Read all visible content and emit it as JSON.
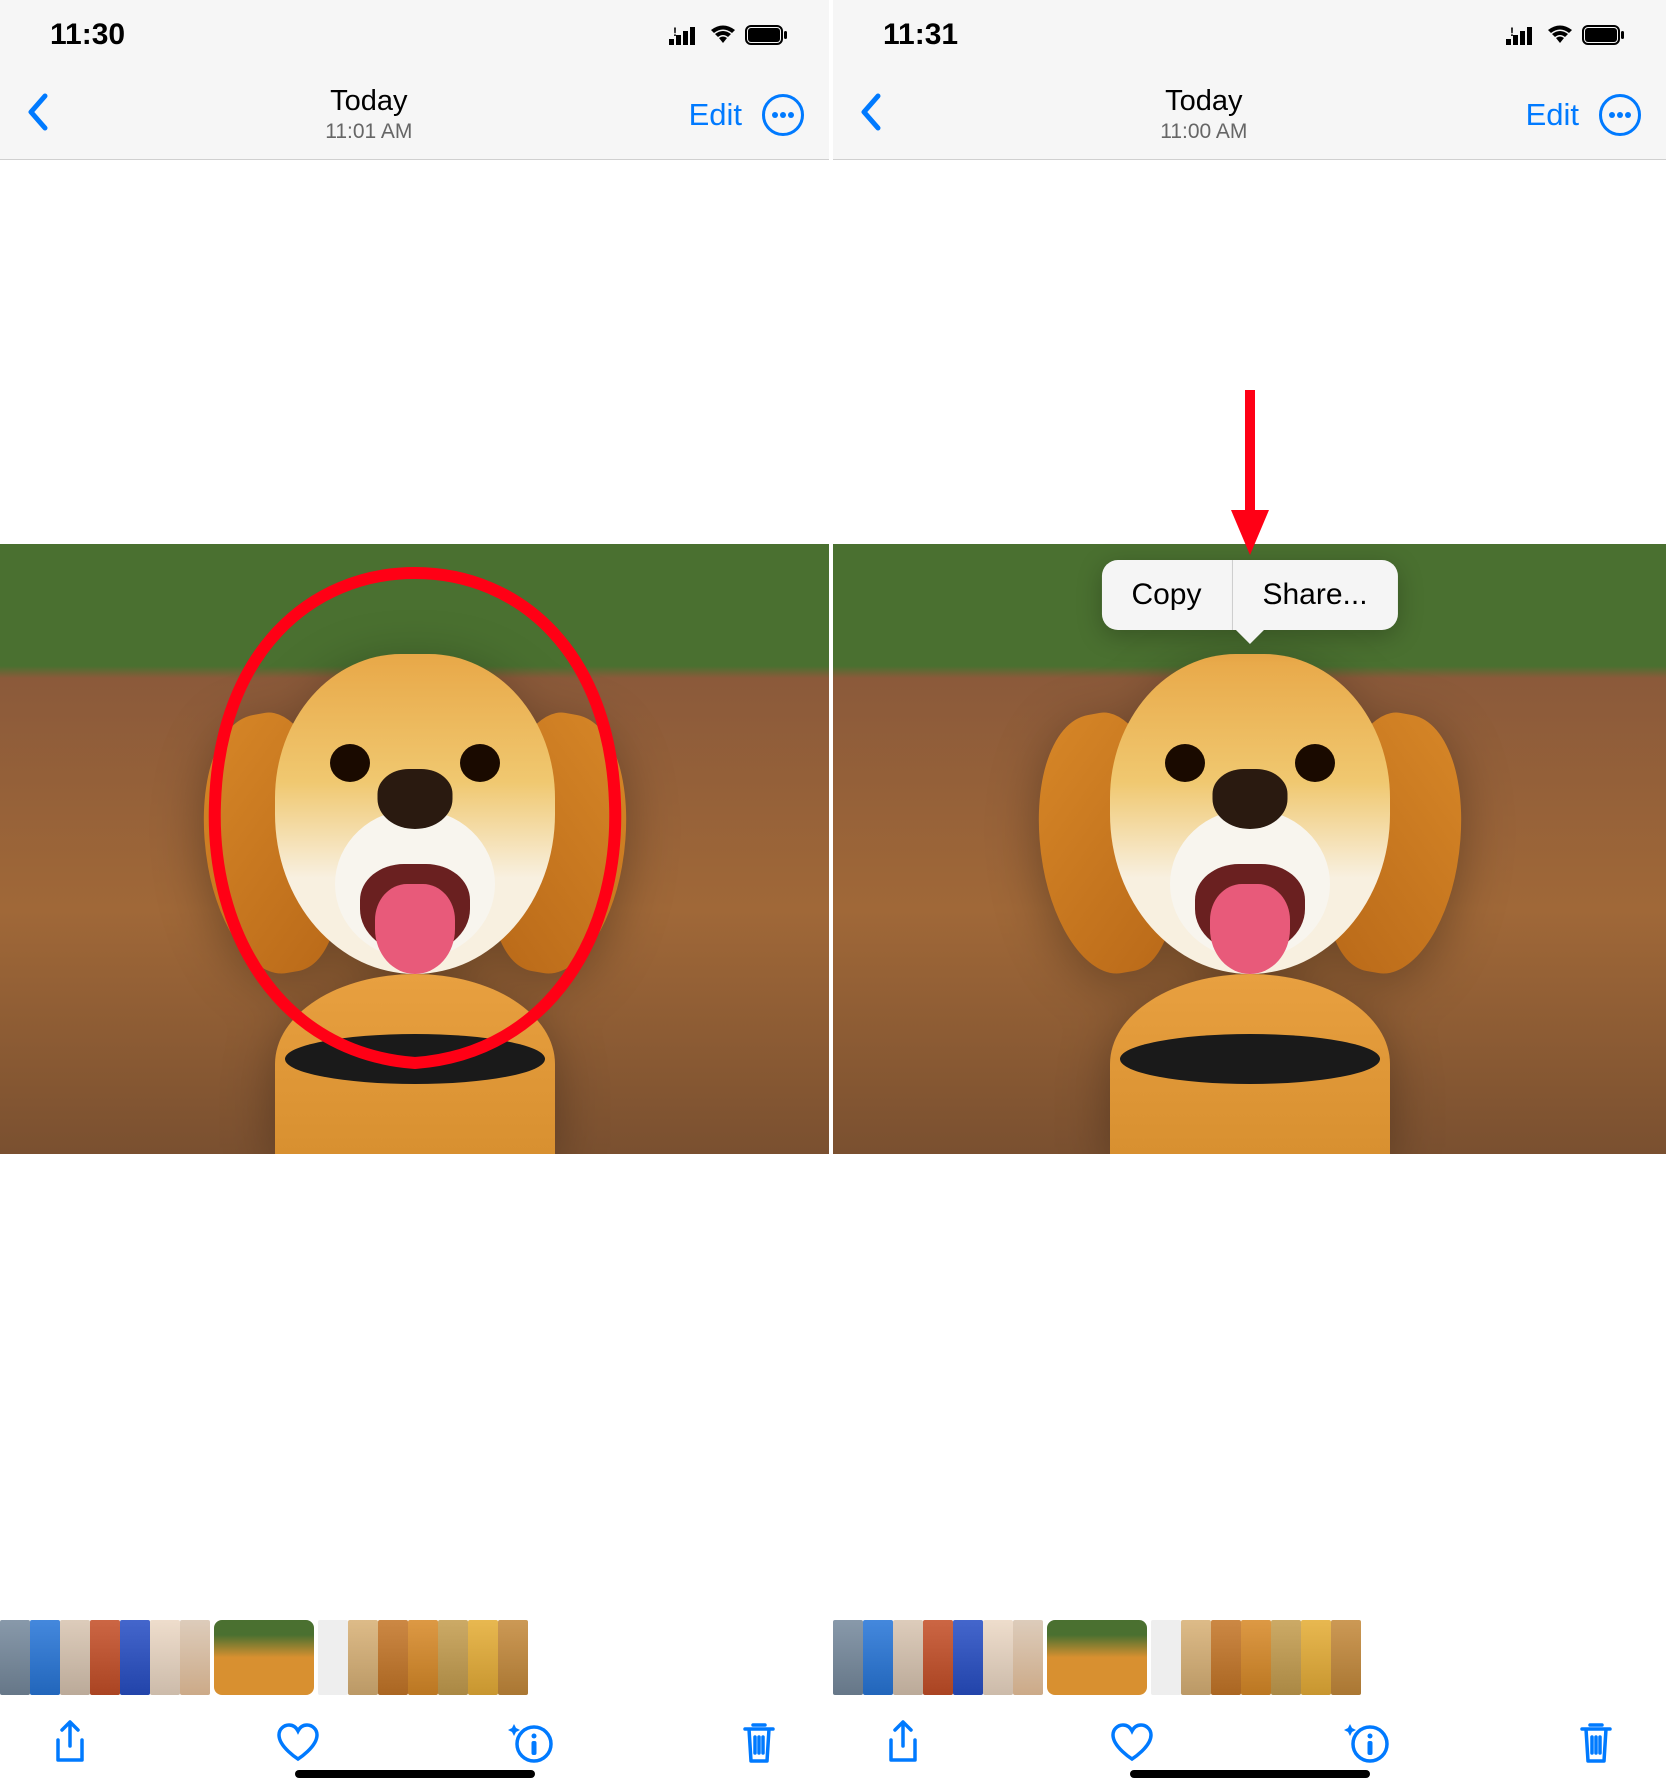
{
  "left": {
    "status": {
      "time": "11:30"
    },
    "nav": {
      "title": "Today",
      "subtitle": "11:01 AM",
      "edit": "Edit"
    }
  },
  "right": {
    "status": {
      "time": "11:31"
    },
    "nav": {
      "title": "Today",
      "subtitle": "11:00 AM",
      "edit": "Edit"
    },
    "context_menu": {
      "copy": "Copy",
      "share": "Share..."
    }
  },
  "colors": {
    "accent": "#007aff",
    "annotation": "#ff0015"
  }
}
